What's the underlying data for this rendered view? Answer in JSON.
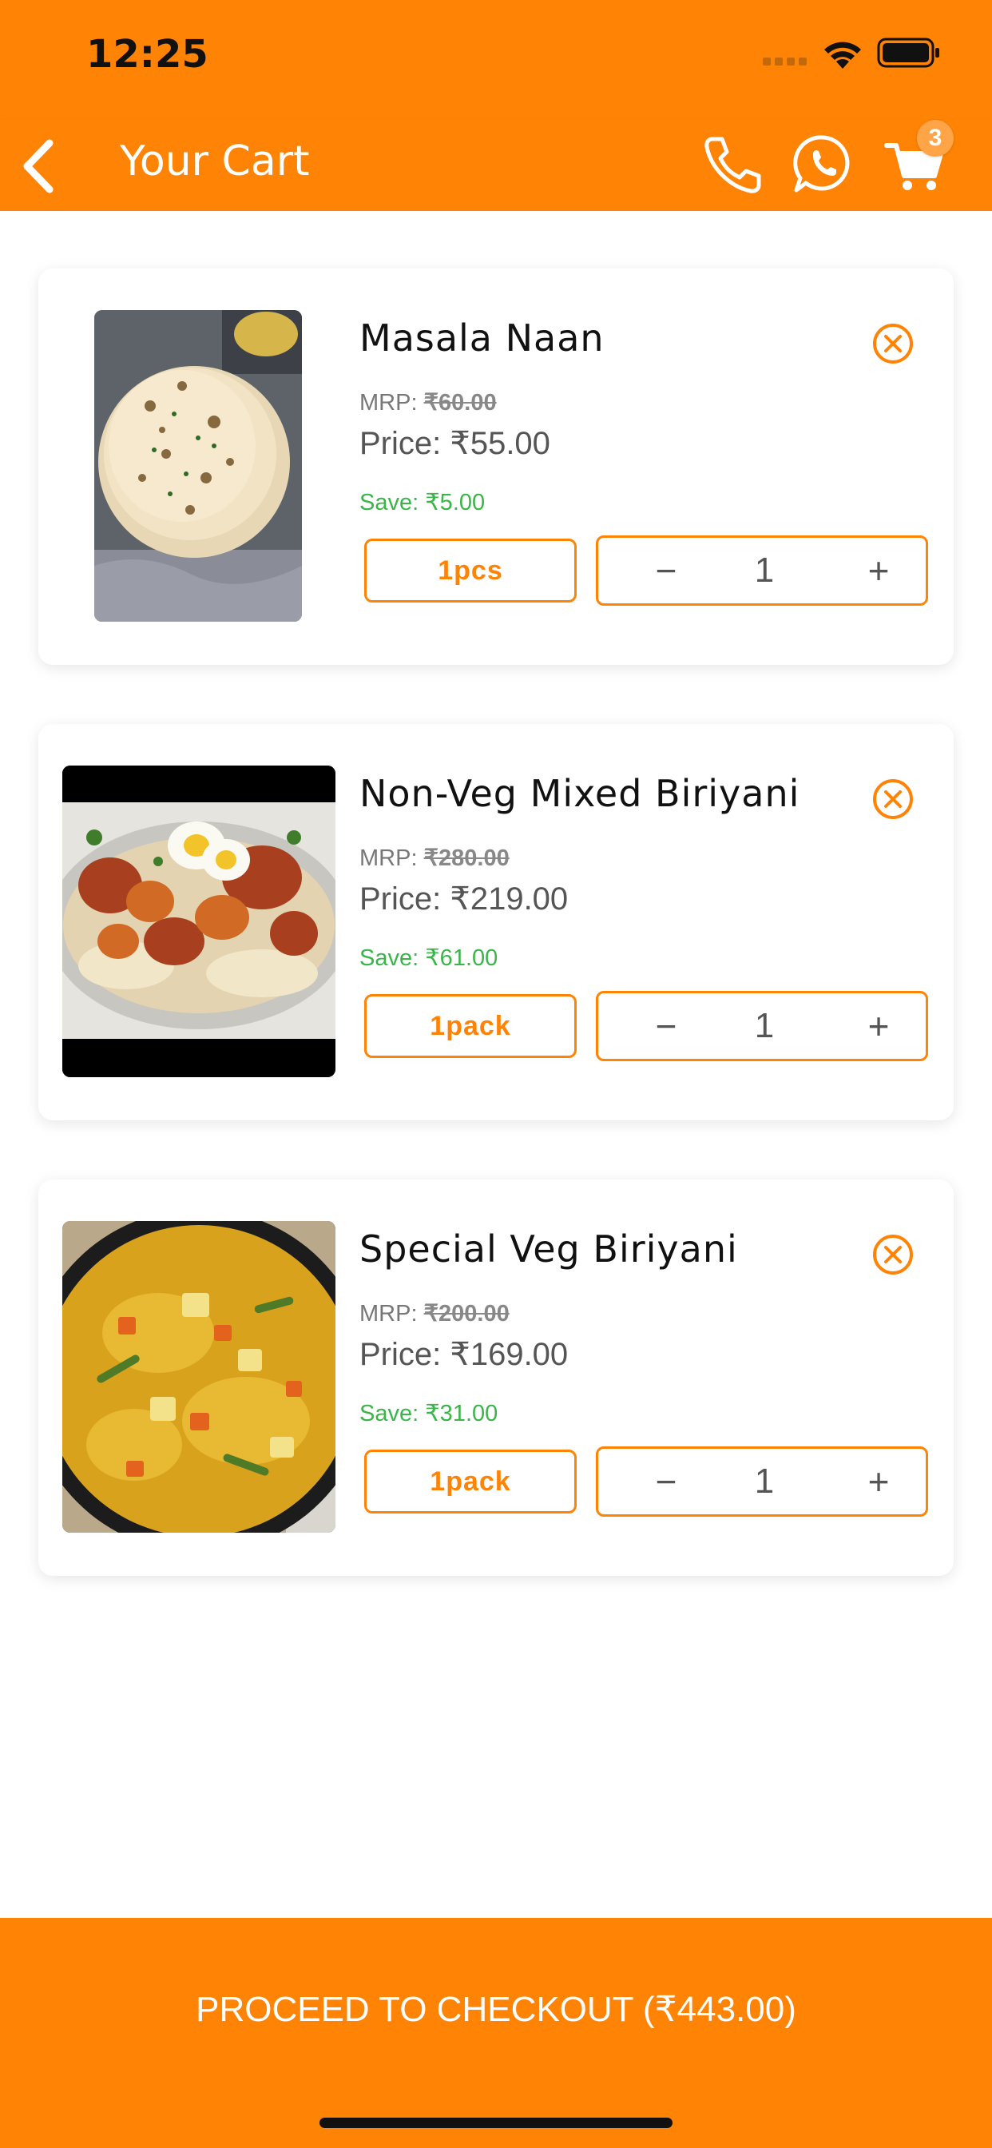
{
  "status_bar": {
    "time": "12:25"
  },
  "header": {
    "title": "Your Cart",
    "cart_count": "3"
  },
  "colors": {
    "accent": "#FF8305",
    "save_green": "#3BB54A"
  },
  "cart_items": [
    {
      "name": "Masala Naan",
      "mrp_label": "MRP:",
      "mrp": "₹60.00",
      "price_label": "Price:",
      "price": "₹55.00",
      "save_label": "Save:",
      "save": "₹5.00",
      "unit": "1pcs",
      "quantity": "1",
      "minus": "−",
      "plus": "+"
    },
    {
      "name": "Non-Veg Mixed Biriyani",
      "mrp_label": "MRP:",
      "mrp": "₹280.00",
      "price_label": "Price:",
      "price": "₹219.00",
      "save_label": "Save:",
      "save": "₹61.00",
      "unit": "1pack",
      "quantity": "1",
      "minus": "−",
      "plus": "+"
    },
    {
      "name": "Special Veg Biriyani",
      "mrp_label": "MRP:",
      "mrp": "₹200.00",
      "price_label": "Price:",
      "price": "₹169.00",
      "save_label": "Save:",
      "save": "₹31.00",
      "unit": "1pack",
      "quantity": "1",
      "minus": "−",
      "plus": "+"
    }
  ],
  "checkout": {
    "label": "PROCEED TO CHECKOUT (₹443.00)"
  }
}
